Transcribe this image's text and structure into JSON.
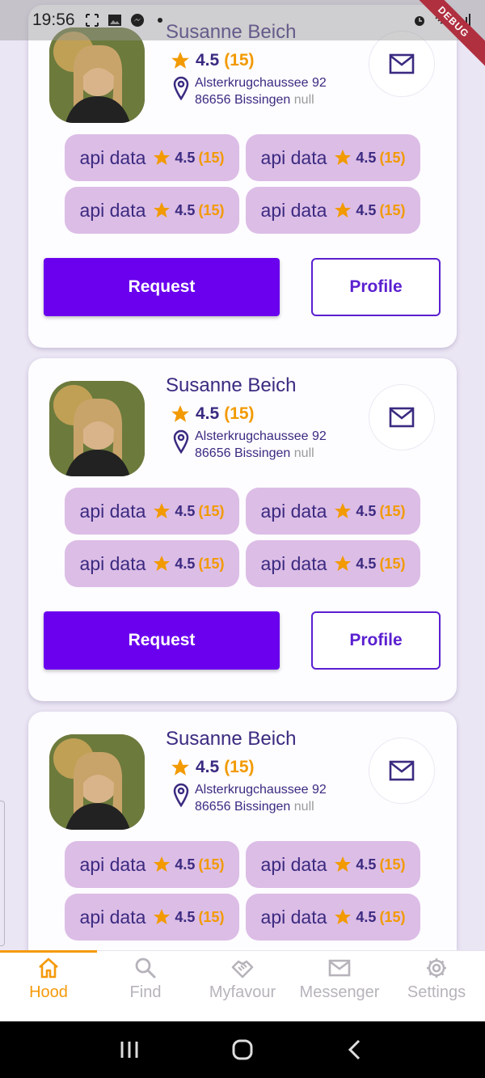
{
  "status_bar": {
    "time": "19:56",
    "debug_label": "DEBUG"
  },
  "colors": {
    "primary": "#6a00ee",
    "accent": "#f59a0a",
    "chip_bg": "#dcbde6",
    "text_dark": "#3b2a80"
  },
  "cards": [
    {
      "name": "Susanne Beich",
      "rating": "4.5",
      "rating_count": "(15)",
      "address_line1": "Alsterkrugchaussee 92",
      "address_line2": "86656 Bissingen",
      "address_suffix": "null",
      "chips": [
        {
          "label": "api data",
          "rating": "4.5",
          "count": "(15)"
        },
        {
          "label": "api data",
          "rating": "4.5",
          "count": "(15)"
        },
        {
          "label": "api data",
          "rating": "4.5",
          "count": "(15)"
        },
        {
          "label": "api data",
          "rating": "4.5",
          "count": "(15)"
        }
      ],
      "request_label": "Request",
      "profile_label": "Profile"
    },
    {
      "name": "Susanne Beich",
      "rating": "4.5",
      "rating_count": "(15)",
      "address_line1": "Alsterkrugchaussee 92",
      "address_line2": "86656 Bissingen",
      "address_suffix": "null",
      "chips": [
        {
          "label": "api data",
          "rating": "4.5",
          "count": "(15)"
        },
        {
          "label": "api data",
          "rating": "4.5",
          "count": "(15)"
        },
        {
          "label": "api data",
          "rating": "4.5",
          "count": "(15)"
        },
        {
          "label": "api data",
          "rating": "4.5",
          "count": "(15)"
        }
      ],
      "request_label": "Request",
      "profile_label": "Profile"
    },
    {
      "name": "Susanne Beich",
      "rating": "4.5",
      "rating_count": "(15)",
      "address_line1": "Alsterkrugchaussee 92",
      "address_line2": "86656 Bissingen",
      "address_suffix": "null",
      "chips": [
        {
          "label": "api data",
          "rating": "4.5",
          "count": "(15)"
        },
        {
          "label": "api data",
          "rating": "4.5",
          "count": "(15)"
        },
        {
          "label": "api data",
          "rating": "4.5",
          "count": "(15)"
        },
        {
          "label": "api data",
          "rating": "4.5",
          "count": "(15)"
        }
      ]
    }
  ],
  "bottom_nav": [
    {
      "label": "Hood",
      "icon": "home-icon",
      "active": true
    },
    {
      "label": "Find",
      "icon": "search-icon",
      "active": false
    },
    {
      "label": "Myfavour",
      "icon": "handshake-icon",
      "active": false
    },
    {
      "label": "Messenger",
      "icon": "mail-icon",
      "active": false
    },
    {
      "label": "Settings",
      "icon": "gear-icon",
      "active": false
    }
  ],
  "system_nav": [
    "recent-apps-icon",
    "home-circle-icon",
    "back-icon"
  ]
}
